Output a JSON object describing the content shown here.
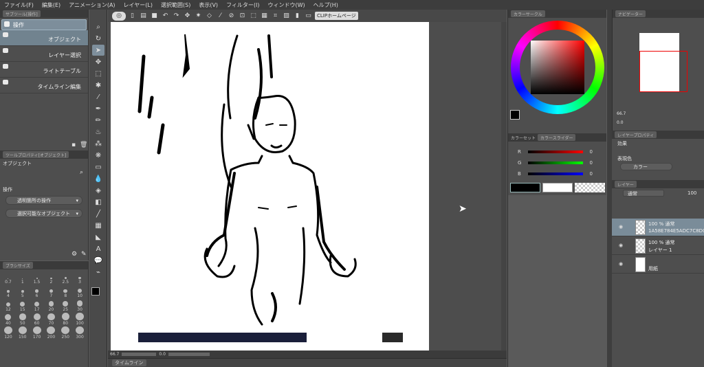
{
  "menu": [
    "ファイル(F)",
    "編集(E)",
    "アニメーション(A)",
    "レイヤー(L)",
    "選択範囲(S)",
    "表示(V)",
    "フィルター(I)",
    "ウィンドウ(W)",
    "ヘルプ(H)"
  ],
  "subtool": {
    "title": "サブツール[操作]",
    "group": "操作",
    "items": [
      {
        "label": "オブジェクト"
      },
      {
        "label": "レイヤー選択"
      },
      {
        "label": "ライトテーブル"
      },
      {
        "label": "タイムライン編集"
      }
    ]
  },
  "toolprop": {
    "title": "ツールプロパティ[オブジェクト]",
    "name": "オブジェクト",
    "section": "操作",
    "opt1": "透明箇所の操作",
    "opt2": "選択可能なオブジェクト"
  },
  "brushsize": {
    "title": "ブラシサイズ",
    "sizes": [
      "0.7",
      "1",
      "1.5",
      "2",
      "2.5",
      "3",
      "4",
      "5",
      "6",
      "7",
      "8",
      "10",
      "12",
      "15",
      "17",
      "20",
      "25",
      "30",
      "40",
      "50",
      "60",
      "70",
      "80",
      "100",
      "120",
      "150",
      "170",
      "200",
      "250",
      "300"
    ]
  },
  "command": {
    "clip_label": "CLIPホームページ"
  },
  "status": {
    "zoom": "66.7",
    "rotate": "0.0"
  },
  "timeline": {
    "title": "タイムライン"
  },
  "colorcircle": {
    "title": "カラーサークル"
  },
  "colorslider": {
    "tab1": "カラーセット",
    "tab2": "カラースライダー",
    "r_label": "R",
    "g_label": "G",
    "b_label": "B",
    "r": "0",
    "g": "0",
    "b": "0"
  },
  "navigator": {
    "title": "ナビゲーター",
    "zoom": "66.7",
    "rotate": "0.0"
  },
  "layerprop": {
    "tab1": "レイヤープロパティ",
    "effect_label": "効果",
    "color_label": "表現色",
    "color_value": "カラー"
  },
  "layers": {
    "tab": "レイヤー",
    "blend": "通常",
    "opacity": "100",
    "rows": [
      {
        "line1": "100 % 通常",
        "line2": "1A58E784E5ADC7C8D0..."
      },
      {
        "line1": "100 % 通常",
        "line2": "レイヤー 1"
      },
      {
        "line1": "",
        "line2": "用紙"
      }
    ]
  }
}
